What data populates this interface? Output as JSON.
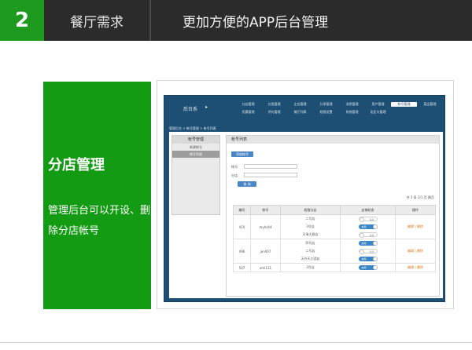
{
  "header": {
    "number": "2",
    "title": "餐厅需求",
    "subtitle": "更加方便的APP后台管理"
  },
  "feature": {
    "title": "分店管理",
    "description": "管理后台可以开设、删除分店帐号"
  },
  "screenshot": {
    "logo": "后台系",
    "logo_dot": "▸",
    "nav_items": [
      "分店管理",
      "分类管理",
      "企业管理",
      "分享管理",
      "消息管理",
      "用户管理",
      "帐号管理",
      "菜品管理",
      "优惠管理",
      "评价管理",
      "餐厅列表",
      "权限设置",
      "系统管理",
      "设定与管理"
    ],
    "active_nav": "帐号管理",
    "breadcrumb": "管理后台 > 帐号管理 > 帐号列表",
    "sidebar": {
      "title": "帐号管理",
      "items": [
        "新建帐号",
        "帐号列表"
      ],
      "active_index": 1
    },
    "main": {
      "title": "帐号列表",
      "add_button": "添加帐号",
      "fields": [
        {
          "label": "帐号:",
          "value": ""
        },
        {
          "label": "分店:",
          "value": ""
        }
      ],
      "search_button": "查 询",
      "pager": "共 3 条 1/1 页  跳页",
      "table": {
        "columns": [
          "编号",
          "帐号",
          "权限分店",
          "店铺状态",
          "操作"
        ],
        "rows": [
          {
            "id": "410",
            "account": "myhsit4",
            "perms": [
              "二号店",
              "3号店",
              "天海大厨店"
            ],
            "status": [
              "off",
              "on",
              "off"
            ],
            "op_edit": "编辑",
            "op_delete": "删除"
          },
          {
            "id": "496",
            "account": "jun007",
            "perms": [
              "四号店",
              "二号店",
              "天外天大酒店"
            ],
            "status": [
              "on",
              "off",
              "on"
            ],
            "op_edit": "编辑",
            "op_delete": "删除"
          },
          {
            "id": "507",
            "account": "ami111",
            "perms": [
              "3号店"
            ],
            "status": [
              "on"
            ],
            "op_edit": "编辑",
            "op_delete": "删除"
          }
        ]
      },
      "toggle_on_label": "启用",
      "toggle_off_label": "停用"
    }
  },
  "colors": {
    "brand_green": "#139c13",
    "header_dark": "#2b2b2b",
    "app_blue": "#1d4f74",
    "accent_blue": "#3a86c6"
  }
}
